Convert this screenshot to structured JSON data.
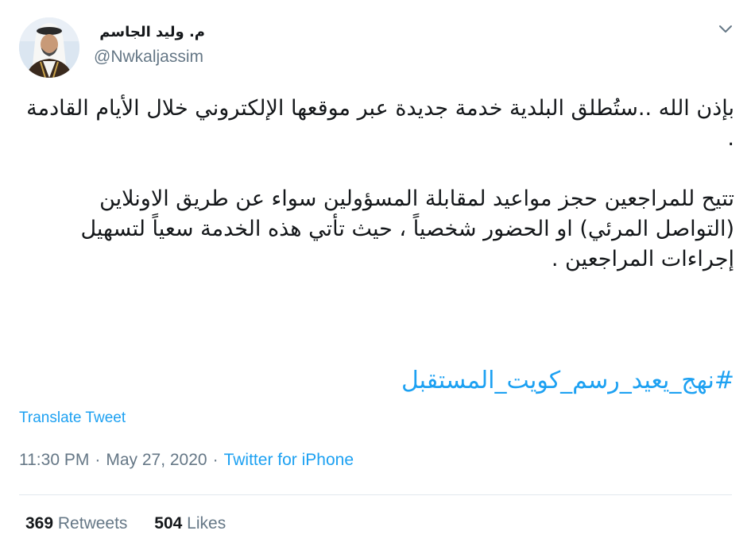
{
  "author": {
    "display_name": "م. وليد الجاسم",
    "handle": "@Nwkaljassim"
  },
  "tweet": {
    "paragraphs": [
      "بإذن الله ..ستُطلق البلدية خدمة جديدة عبر موقعها الإلكتروني خلال الأيام القادمة .",
      "تتيح للمراجعين حجز مواعيد لمقابلة المسؤولين سواء عن طريق الاونلاين (التواصل المرئي) او الحضور شخصياً ، حيث تأتي هذه الخدمة سعياً لتسهيل إجراءات المراجعين ."
    ],
    "hashtag": "#نهج_يعيد_رسم_كويت_المستقبل",
    "translate_label": "Translate Tweet"
  },
  "meta": {
    "time": "11:30 PM",
    "separator": "·",
    "date": "May 27, 2020",
    "source": "Twitter for iPhone"
  },
  "stats": {
    "retweets_count": "369",
    "retweets_label": "Retweets",
    "likes_count": "504",
    "likes_label": "Likes"
  },
  "icons": {
    "menu": "chevron-down-icon"
  },
  "colors": {
    "link": "#1da1f2",
    "secondary_text": "#657786",
    "primary_text": "#14171a",
    "divider": "#e1e8ed"
  }
}
